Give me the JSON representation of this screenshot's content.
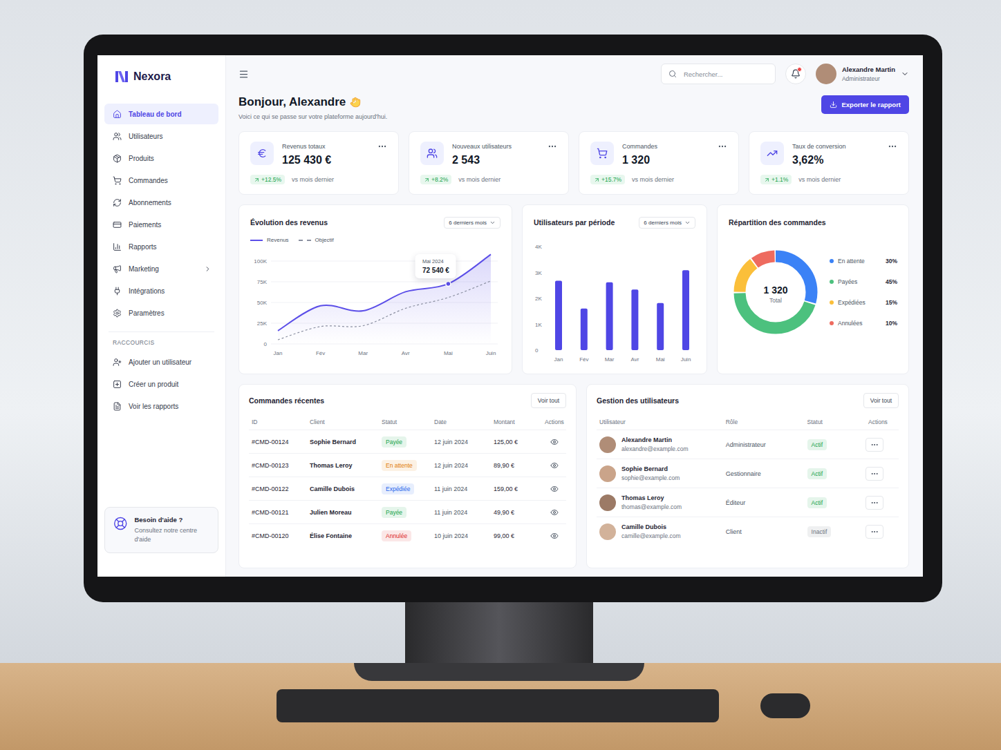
{
  "app": {
    "logo": "Nexora"
  },
  "sidebar": {
    "items": [
      {
        "label": "Tableau de bord",
        "selected": true,
        "expandable": false
      },
      {
        "label": "Utilisateurs",
        "selected": false,
        "expandable": false
      },
      {
        "label": "Produits",
        "selected": false,
        "expandable": false
      },
      {
        "label": "Commandes",
        "selected": false,
        "expandable": false
      },
      {
        "label": "Abonnements",
        "selected": false,
        "expandable": false
      },
      {
        "label": "Paiements",
        "selected": false,
        "expandable": false
      },
      {
        "label": "Rapports",
        "selected": false,
        "expandable": false
      },
      {
        "label": "Marketing",
        "selected": false,
        "expandable": true
      },
      {
        "label": "Intégrations",
        "selected": false,
        "expandable": false
      },
      {
        "label": "Paramètres",
        "selected": false,
        "expandable": false
      }
    ],
    "shortcuts_title": "RACCOURCIS",
    "shortcuts": [
      "Ajouter un utilisateur",
      "Créer un produit",
      "Voir les rapports"
    ],
    "help": {
      "title": "Besoin d'aide ?",
      "text": "Consultez notre centre d'aide"
    }
  },
  "topbar": {
    "search": {
      "placeholder": "Rechercher..."
    },
    "notifications": {
      "unread": true
    },
    "user": {
      "name": "Alexandre Martin",
      "role": "Administrateur"
    }
  },
  "header": {
    "title": "Bonjour, Alexandre",
    "subtitle": "Voici ce qui se passe sur votre plateforme aujourd'hui.",
    "export_button": "Exporter le rapport"
  },
  "stats": [
    {
      "label": "Revenus totaux",
      "value": "125 430 €",
      "change": "+12.5%",
      "compare": "vs mois dernier"
    },
    {
      "label": "Nouveaux utilisateurs",
      "value": "2 543",
      "change": "+8.2%",
      "compare": "vs mois dernier"
    },
    {
      "label": "Commandes",
      "value": "1 320",
      "change": "+15.7%",
      "compare": "vs mois dernier"
    },
    {
      "label": "Taux de conversion",
      "value": "3,62%",
      "change": "+1.1%",
      "compare": "vs mois dernier"
    }
  ],
  "revenue_chart": {
    "title": "Évolution des revenus",
    "period": "6 derniers mois",
    "series": [
      {
        "name": "Revenus",
        "color": "#5b4ee8",
        "dashed": false,
        "values": [
          16000,
          46000,
          40000,
          63000,
          72540,
          108000
        ]
      },
      {
        "name": "Objectif",
        "color": "#8a8fa0",
        "dashed": true,
        "values": [
          5000,
          21000,
          22000,
          43000,
          56000,
          76000
        ]
      }
    ],
    "y_ticks": [
      "100K",
      "75K",
      "50K",
      "25K",
      "0"
    ],
    "x_labels": [
      "Jan",
      "Fév",
      "Mar",
      "Avr",
      "Mai",
      "Juin"
    ],
    "tooltip": {
      "index": 4,
      "label": "Mai 2024",
      "value": "72 540 €"
    }
  },
  "users_chart": {
    "title": "Utilisateurs par période",
    "period": "6 derniers mois",
    "y_ticks": [
      "4K",
      "3K",
      "2K",
      "1K",
      "0"
    ],
    "x_labels": [
      "Jan",
      "Fév",
      "Mar",
      "Avr",
      "Mai",
      "Juin"
    ],
    "values": [
      2680,
      1610,
      2620,
      2340,
      1820,
      3090
    ]
  },
  "orders_donut": {
    "title": "Répartition des commandes",
    "total": "1 320",
    "total_label": "Total",
    "segments": [
      {
        "label": "En attente",
        "percent": "30%",
        "value": 30,
        "color": "#3b82f6"
      },
      {
        "label": "Payées",
        "percent": "45%",
        "value": 45,
        "color": "#4cc17e"
      },
      {
        "label": "Expédiées",
        "percent": "15%",
        "value": 15,
        "color": "#fbbf3a"
      },
      {
        "label": "Annulées",
        "percent": "10%",
        "value": 10,
        "color": "#ee6b5f"
      }
    ]
  },
  "recent_orders": {
    "title": "Commandes récentes",
    "view_all": "Voir tout",
    "columns": [
      "ID",
      "Client",
      "Statut",
      "Date",
      "Montant",
      "Actions"
    ],
    "rows": [
      {
        "id": "#CMD-00124",
        "client": "Sophie Bernard",
        "status": "Payée",
        "color": "#16a34a",
        "date": "12 juin 2024",
        "amount": "125,00 €"
      },
      {
        "id": "#CMD-00123",
        "client": "Thomas Leroy",
        "status": "En attente",
        "color": "#e07b0a",
        "date": "12 juin 2024",
        "amount": "89,90 €"
      },
      {
        "id": "#CMD-00122",
        "client": "Camille Dubois",
        "status": "Expédiée",
        "color": "#2563eb",
        "date": "11 juin 2024",
        "amount": "159,00 €"
      },
      {
        "id": "#CMD-00121",
        "client": "Julien Moreau",
        "status": "Payée",
        "color": "#16a34a",
        "date": "11 juin 2024",
        "amount": "49,90 €"
      },
      {
        "id": "#CMD-00120",
        "client": "Élise Fontaine",
        "status": "Annulée",
        "color": "#dc2626",
        "date": "10 juin 2024",
        "amount": "99,00 €"
      }
    ]
  },
  "users_table": {
    "title": "Gestion des utilisateurs",
    "view_all": "Voir tout",
    "columns": [
      "Utilisateur",
      "Rôle",
      "Statut",
      "Actions"
    ],
    "rows": [
      {
        "name": "Alexandre Martin",
        "email": "alexandre@example.com",
        "role": "Administrateur",
        "status": "Actif",
        "color": "#16a34a"
      },
      {
        "name": "Sophie Bernard",
        "email": "sophie@example.com",
        "role": "Gestionnaire",
        "status": "Actif",
        "color": "#16a34a"
      },
      {
        "name": "Thomas Leroy",
        "email": "thomas@example.com",
        "role": "Éditeur",
        "status": "Actif",
        "color": "#16a34a"
      },
      {
        "name": "Camille Dubois",
        "email": "camille@example.com",
        "role": "Client",
        "status": "Inactif",
        "color": "#6b7280"
      }
    ]
  }
}
